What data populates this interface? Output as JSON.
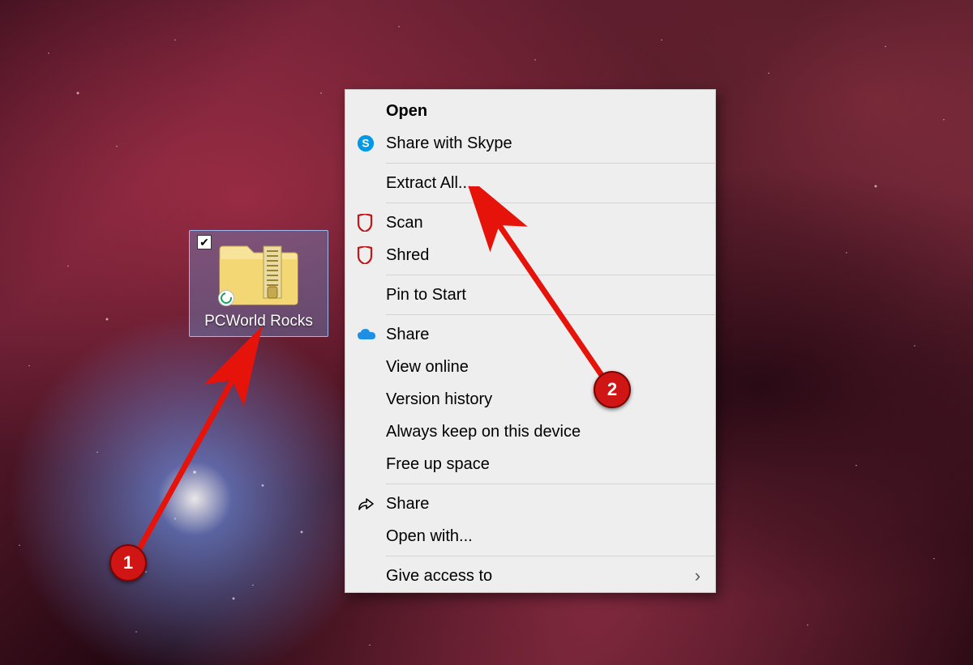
{
  "desktop": {
    "icon": {
      "filename": "PCWorld Rocks",
      "selected": true,
      "checked": true,
      "sync_state": "synced"
    }
  },
  "context_menu": {
    "items": [
      {
        "label": "Open",
        "bold": true,
        "icon": null
      },
      {
        "label": "Share with Skype",
        "icon": "skype"
      },
      {
        "sep": true
      },
      {
        "label": "Extract All...",
        "icon": null
      },
      {
        "sep": true
      },
      {
        "label": "Scan",
        "icon": "mcafee"
      },
      {
        "label": "Shred",
        "icon": "mcafee"
      },
      {
        "sep": true
      },
      {
        "label": "Pin to Start",
        "icon": null
      },
      {
        "sep": true
      },
      {
        "label": "Share",
        "icon": "onedrive"
      },
      {
        "label": "View online",
        "icon": null
      },
      {
        "label": "Version history",
        "icon": null
      },
      {
        "label": "Always keep on this device",
        "icon": null
      },
      {
        "label": "Free up space",
        "icon": null
      },
      {
        "sep": true
      },
      {
        "label": "Share",
        "icon": "share-arrow"
      },
      {
        "label": "Open with...",
        "icon": null
      },
      {
        "sep": true
      },
      {
        "label": "Give access to",
        "icon": null,
        "submenu": true
      }
    ]
  },
  "annotations": {
    "1": {
      "number": "1"
    },
    "2": {
      "number": "2"
    }
  }
}
